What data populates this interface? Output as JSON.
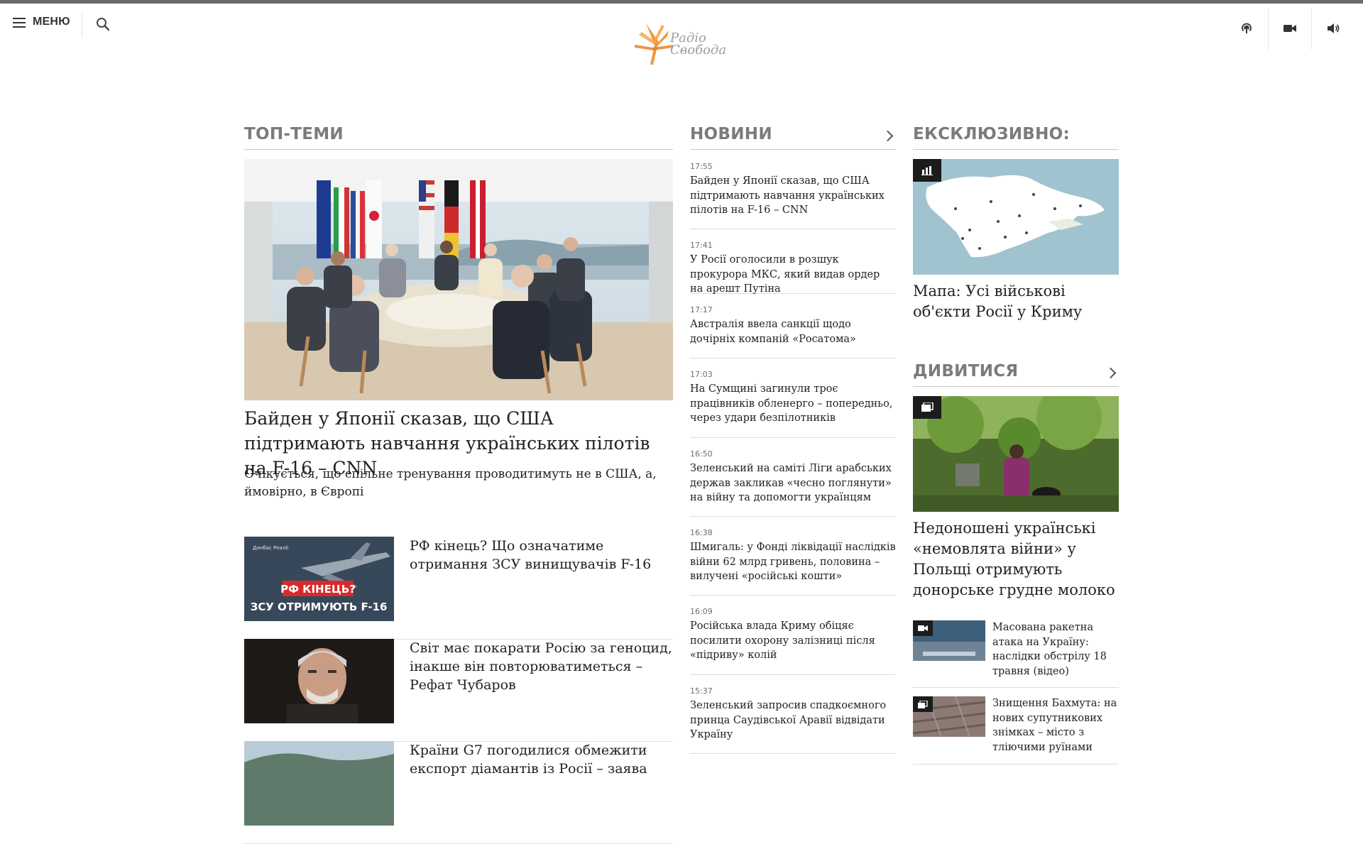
{
  "header": {
    "menu_label": "МЕНЮ",
    "logo_line1": "Радіо",
    "logo_line2": "Свобода",
    "icons": [
      "podcast-icon",
      "video-camera-icon",
      "speaker-icon"
    ]
  },
  "colors": {
    "top_bar": "#6a6a6a",
    "section_title": "#7b7b7b",
    "logo_orange": "#f28c28"
  },
  "top": {
    "title": "ТОП-ТЕМИ",
    "hero_title": "Байден у Японії сказав, що США підтримають навчання українських пілотів на F-16 – CNN",
    "hero_subtitle": "Очікується, що спільне тренування проводитимуть не в США, а, ймовірно, в Європі",
    "stories": [
      {
        "title": "РФ кінець? Що означатиме отримання ЗСУ винищувачів F-16",
        "thumb_brand": "Донбас Реалії",
        "thumb_caption1": "РФ КІНЕЦЬ?",
        "thumb_caption2": "ЗСУ ОТРИМУЮТЬ F-16"
      },
      {
        "title": "Світ має покарати Росію за геноцид, інакше він повторюватиметься – Рефат Чубаров"
      },
      {
        "title": "Країни G7 погодилися обмежити експорт діамантів із Росії – заява"
      }
    ]
  },
  "news": {
    "title": "НОВИНИ",
    "items": [
      {
        "time": "17:55",
        "text": "Байден у Японії сказав, що США підтримають навчання українських пілотів на F-16 – CNN"
      },
      {
        "time": "17:41",
        "text": "У Росії оголосили в розшук прокурора МКС, який видав ордер на арешт Путіна"
      },
      {
        "time": "17:17",
        "text": "Австралія ввела санкції щодо дочірніх компаній «Росатома»"
      },
      {
        "time": "17:03",
        "text": "На Сумщині загинули троє працівників обленерго – попередньо, через удари безпілотників"
      },
      {
        "time": "16:50",
        "text": "Зеленський на саміті Ліги арабських держав закликав «чесно поглянути» на війну та допомогти українцям"
      },
      {
        "time": "16:38",
        "text": "Шмигаль: у Фонді ліквідації наслідків війни 62 млрд гривень, половина – вилучені «російські кошти»"
      },
      {
        "time": "16:09",
        "text": "Російська влада Криму обіцяє посилити охорону залізниці після «підриву» колій"
      },
      {
        "time": "15:37",
        "text": "Зеленський запросив спадкоємного принца Саудівської Аравії відвідати Україну"
      }
    ]
  },
  "exclusive": {
    "title": "ЕКСКЛЮЗИВНО:",
    "link": "Мапа: Усі військові об'єкти Росії у Криму"
  },
  "watch": {
    "title": "ДИВИТИСЯ",
    "main_link": "Недоношені українські «немовлята війни» у Польщі отримують донорське грудне молоко",
    "items": [
      {
        "title": "Масована ракетна атака на Україну: наслідки обстрілу 18 травня (відео)"
      },
      {
        "title": "Знищення Бахмута: на нових супутникових знімках – місто з тліючими руїнами"
      }
    ]
  }
}
